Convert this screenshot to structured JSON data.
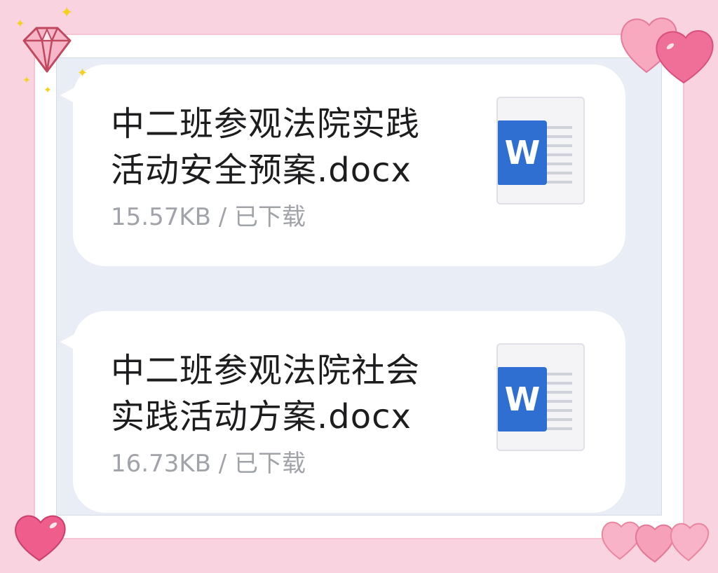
{
  "files": [
    {
      "name_line1": "中二班参观法院实践",
      "name_line2": "活动安全预案.docx",
      "meta": "15.57KB / 已下载",
      "icon_letter": "W"
    },
    {
      "name_line1": "中二班参观法院社会",
      "name_line2": "实践活动方案.docx",
      "meta": "16.73KB / 已下载",
      "icon_letter": "W"
    }
  ],
  "icons": {
    "file_icon": "word-doc-icon",
    "decorations": [
      "diamond-icon",
      "heart-icon",
      "sparkle-icon"
    ]
  },
  "colors": {
    "background": "#f9d3df",
    "chat_area": "#e9edf6",
    "word_blue": "#2f6fd1",
    "meta_text": "#a0a3a8"
  }
}
